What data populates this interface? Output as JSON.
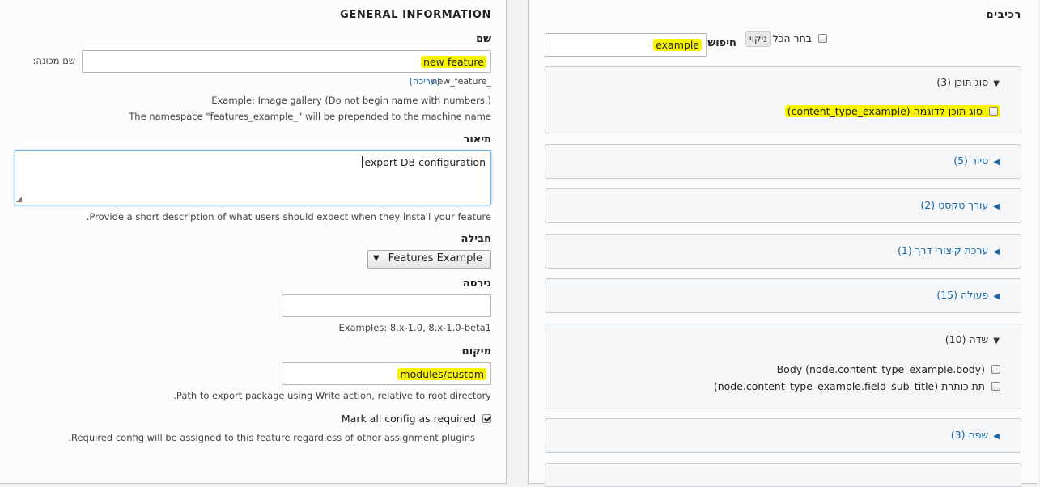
{
  "left": {
    "heading": "GENERAL INFORMATION",
    "name": {
      "label": "שם",
      "value": "new feature",
      "machine_name_label": "שם מכונה:",
      "machine_name_value": "new_feature_",
      "edit_link": "[עריכה]",
      "help_1": "Example: Image gallery (Do not begin name with numbers.)",
      "help_2": "The namespace \"features_example_\" will be prepended to the machine name"
    },
    "description": {
      "label": "תיאור",
      "value": "export DB configuration",
      "help": "Provide a short description of what users should expect when they install your feature."
    },
    "bundle": {
      "label": "חבילה",
      "selected": "Features Example"
    },
    "version": {
      "label": "גירסה",
      "value": "",
      "help": "Examples: 8.x-1.0, 8.x-1.0-beta1"
    },
    "path": {
      "label": "מיקום",
      "value": "modules/custom",
      "help": "Path to export package using Write action, relative to root directory."
    },
    "required": {
      "label": "Mark all config as required",
      "checked": true,
      "help": "Required config will be assigned to this feature regardless of other assignment plugins."
    }
  },
  "right": {
    "heading": "רכיבים",
    "select_all_label": "בחר הכל",
    "clear_button": "ניקוי",
    "search_label": "חיפוש",
    "search_value": "example",
    "sections": [
      {
        "title": "סוג תוכן",
        "count": "(3)",
        "open": true,
        "items": [
          {
            "label": "סוג תוכן לדוגמה (content_type_example)"
          }
        ]
      },
      {
        "title": "סיור",
        "count": "(5)",
        "open": false
      },
      {
        "title": "עורך טקסט",
        "count": "(2)",
        "open": false
      },
      {
        "title": "ערכת קיצורי דרך",
        "count": "(1)",
        "open": false
      },
      {
        "title": "פעולה",
        "count": "(15)",
        "open": false
      },
      {
        "title": "שדה",
        "count": "(10)",
        "open": true,
        "items": [
          {
            "label": "Body (node.content_type_example.body)"
          },
          {
            "label": "תת כותרת (node.content_type_example.field_sub_title)"
          }
        ]
      },
      {
        "title": "שפה",
        "count": "(3)",
        "open": false
      }
    ]
  }
}
